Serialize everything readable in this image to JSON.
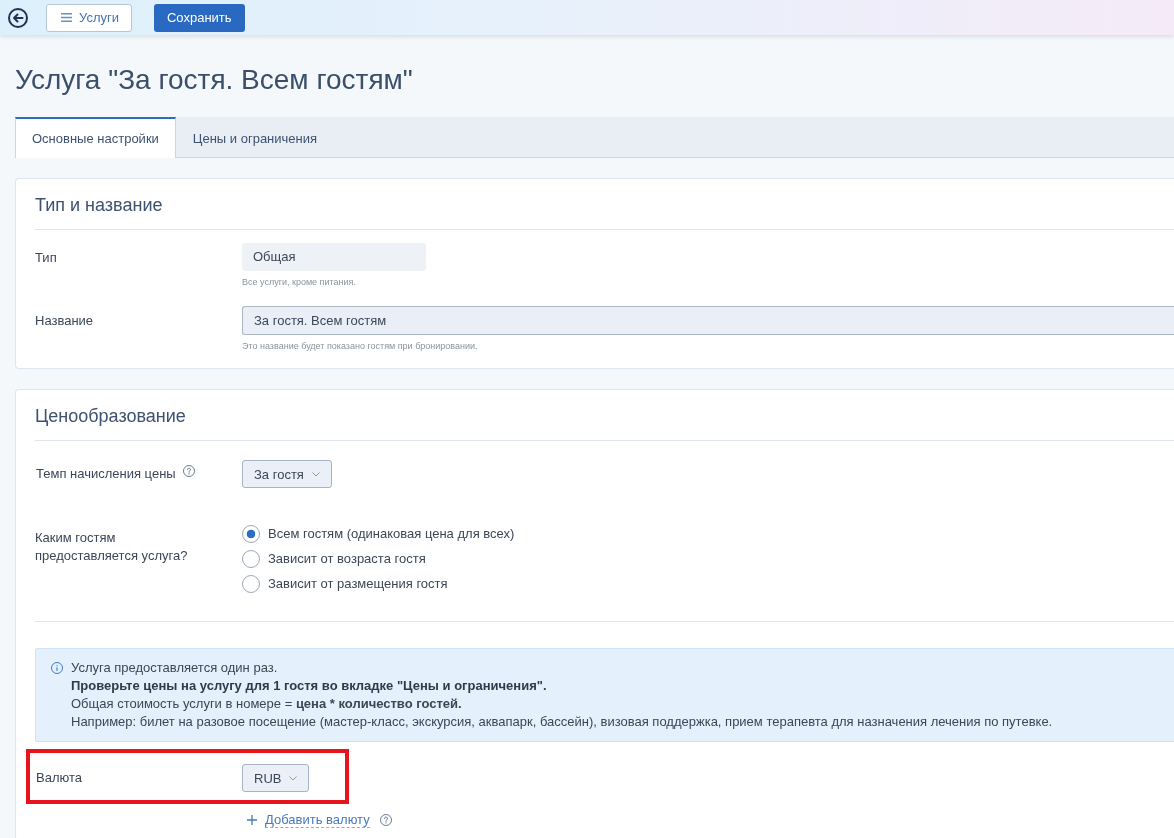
{
  "toolbar": {
    "menu_button": {
      "label": "Услуги"
    },
    "save_button": {
      "label": "Сохранить"
    }
  },
  "title": "Услуга \"За гостя. Всем гостям\"",
  "tabs": [
    {
      "label": "Основные настройки",
      "selected": true
    },
    {
      "label": "Цены и ограничения",
      "selected": false
    }
  ],
  "sections": [
    {
      "title": "Тип и название",
      "fields": [
        {
          "kind": "readonly",
          "label": "Тип",
          "value": "Общая",
          "hint": "Все услуги, кроме питания."
        },
        {
          "kind": "input",
          "label": "Название",
          "value": "За гостя. Всем гостям",
          "hint": "Это название будет показано гостям при бронировании."
        }
      ]
    },
    {
      "title": "Ценообразование",
      "fields": [
        {
          "kind": "select",
          "label": "Темп начисления цены",
          "help": true,
          "value": "За гостя"
        },
        {
          "kind": "radio",
          "label": "Каким гостям предоставляется услуга?",
          "options": [
            {
              "label": "Всем гостям (одинаковая цена для всех)",
              "selected": true
            },
            {
              "label": "Зависит от возраста гостя",
              "selected": false
            },
            {
              "label": "Зависит от размещения гостя",
              "selected": false
            }
          ]
        },
        {
          "kind": "info",
          "lines": [
            {
              "text": "Услуга предоставляется один раз.",
              "bold": false
            },
            {
              "text": "Проверьте цены на услугу для 1 гостя во вкладке \"Цены и ограничения\".",
              "bold": true
            },
            {
              "text": "Общая стоимость услуги в номере = **цена * количество гостей.**",
              "bold": false
            },
            {
              "text": "Например: билет на разовое посещение (мастер-класс, экскурсия, аквапарк, бассейн), визовая поддержка, прием терапевта для назначения лечения по путевке.",
              "bold": false
            }
          ]
        },
        {
          "kind": "select",
          "label": "Валюта",
          "value": "RUB",
          "highlighted": true,
          "add_link": {
            "label": "Добавить валюту",
            "help": true
          }
        }
      ]
    }
  ]
}
